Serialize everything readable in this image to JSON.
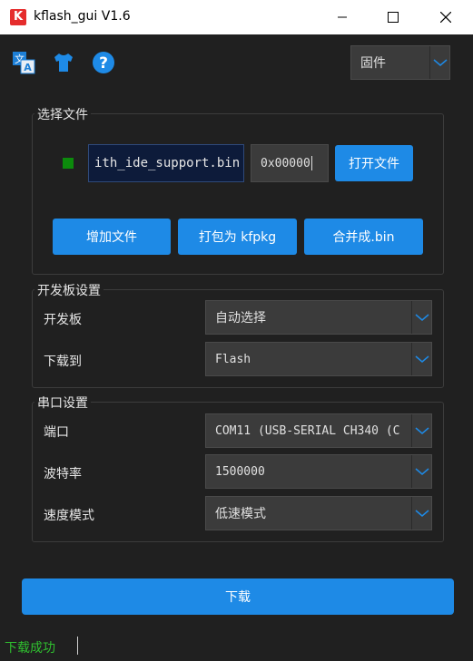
{
  "window": {
    "title": "kflash_gui V1.6",
    "logo_letter": "K"
  },
  "toolbar": {
    "icons": [
      "language-icon",
      "skin-icon",
      "help-icon"
    ],
    "mode_select": "固件"
  },
  "file_group": {
    "title": "选择文件",
    "file_name": "ith_ide_support.bin",
    "address": "0x00000",
    "open_label": "打开文件",
    "add_label": "增加文件",
    "pack_label": "打包为 kfpkg",
    "merge_label": "合并成.bin"
  },
  "board_group": {
    "title": "开发板设置",
    "board_label": "开发板",
    "board_value": "自动选择",
    "target_label": "下载到",
    "target_value": "Flash"
  },
  "serial_group": {
    "title": "串口设置",
    "port_label": "端口",
    "port_value": "COM11 (USB-SERIAL CH340 (C",
    "baud_label": "波特率",
    "baud_value": "1500000",
    "speed_label": "速度模式",
    "speed_value": "低速模式"
  },
  "download_label": "下载",
  "status": "下载成功",
  "colors": {
    "accent": "#1e8ae6",
    "success": "#2fbf2f",
    "background": "#202020"
  }
}
